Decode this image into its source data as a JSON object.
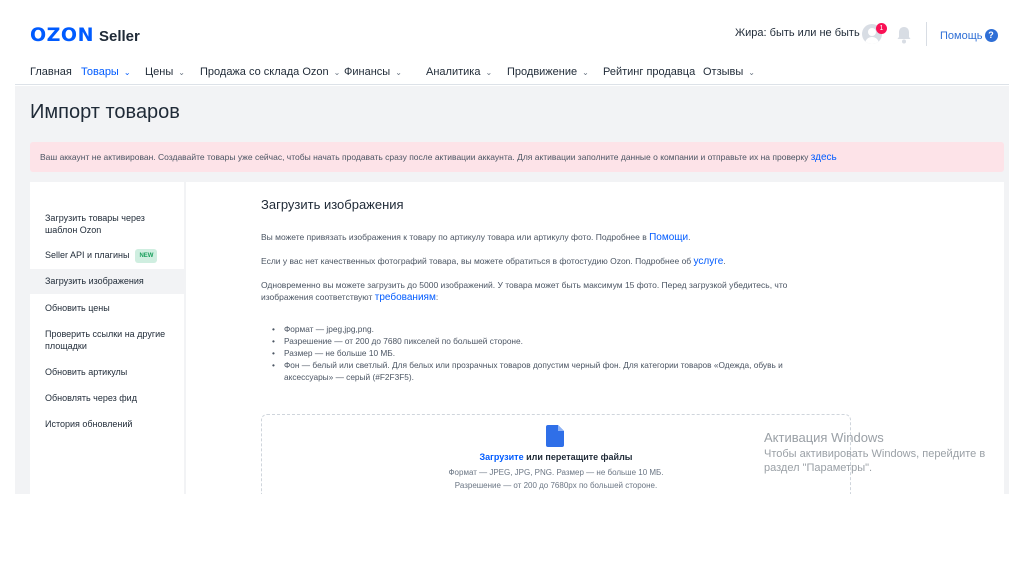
{
  "header": {
    "logo_brand": "OZON",
    "logo_product": "Seller",
    "company": "Жира: быть или не быть",
    "notification_count": "1",
    "help_label": "Помощь",
    "help_icon": "?"
  },
  "nav": {
    "items": [
      {
        "label": "Главная",
        "dropdown": false
      },
      {
        "label": "Товары",
        "dropdown": true,
        "active": true
      },
      {
        "label": "Цены",
        "dropdown": true
      },
      {
        "label": "Продажа со склада Ozon",
        "dropdown": true
      },
      {
        "label": "Финансы",
        "dropdown": true
      },
      {
        "label": "Аналитика",
        "dropdown": true
      },
      {
        "label": "Продвижение",
        "dropdown": true
      },
      {
        "label": "Рейтинг продавца",
        "dropdown": false
      },
      {
        "label": "Отзывы",
        "dropdown": true
      }
    ],
    "chevron": "⌄"
  },
  "page": {
    "title": "Импорт товаров",
    "alert_text": "Ваш аккаунт не активирован. Создавайте товары уже сейчас, чтобы начать продавать сразу после активации аккаунта. Для активации заполните данные о компании и отправьте их на проверку",
    "alert_link": "здесь"
  },
  "sidebar": {
    "items": [
      {
        "label": "Загрузить товары через шаблон Ozon"
      },
      {
        "label": "Seller API и плагины",
        "badge": "NEW"
      },
      {
        "label": "Загрузить изображения",
        "active": true
      },
      {
        "label": "Обновить цены"
      },
      {
        "label": "Проверить ссылки на другие площадки"
      },
      {
        "label": "Обновить артикулы"
      },
      {
        "label": "Обновлять через фид"
      },
      {
        "label": "История обновлений"
      }
    ]
  },
  "content": {
    "title": "Загрузить изображения",
    "p1": "Вы можете привязать изображения к товару по артикулу товара или артикулу фото. Подробнее в",
    "p1_link": "Помощи",
    "p1_end": ".",
    "p2": "Если у вас нет качественных фотографий товара, вы можете обратиться в фотостудию Ozon. Подробнее об",
    "p2_link": "услуге",
    "p2_end": ".",
    "p3": "Одновременно вы можете загрузить до 5000 изображений. У товара может быть максимум 15 фото. Перед загрузкой убедитесь, что изображения соответствуют",
    "p3_link": "требованиям",
    "p3_end": ":",
    "requirements": [
      "Формат — jpeg,jpg,png.",
      "Разрешение — от 200 до 7680 пикселей по большей стороне.",
      "Размер — не больше 10 МБ.",
      "Фон — белый или светлый. Для белых или прозрачных товаров допустим черный фон. Для категории товаров «Одежда, обувь и аксессуары» — серый (#F2F3F5)."
    ]
  },
  "dropzone": {
    "link": "Загрузите",
    "text": "или перетащите файлы",
    "hint1": "Формат — JPEG, JPG, PNG. Размер — не больше 10 МБ.",
    "hint2": "Разрешение — от 200 до 7680px по большей стороне."
  },
  "watermark": {
    "title": "Активация Windows",
    "text": "Чтобы активировать Windows, перейдите в раздел \"Параметры\"."
  },
  "colors": {
    "accent": "#005bff",
    "alert_bg": "#fde3e8",
    "badge_red": "#f91155",
    "new_badge": "#1a9f5c"
  }
}
